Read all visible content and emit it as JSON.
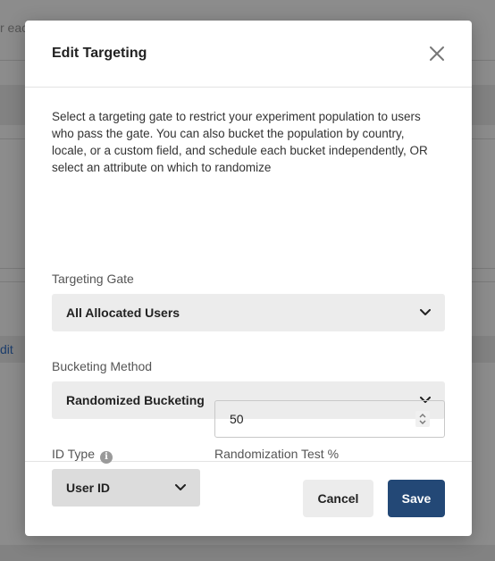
{
  "background": {
    "partial_text": "r eac",
    "partial_link": "dit"
  },
  "modal": {
    "title": "Edit Targeting",
    "description": "Select a targeting gate to restrict your experiment population to users who pass the gate. You can also bucket the population by country, locale, or a custom field, and schedule each bucket independently, OR select an attribute on which to randomize",
    "targeting_gate": {
      "label": "Targeting Gate",
      "value": "All Allocated Users"
    },
    "bucketing_method": {
      "label": "Bucketing Method",
      "value": "Randomized Bucketing"
    },
    "id_type": {
      "label": "ID Type",
      "value": "User ID"
    },
    "randomization_test": {
      "label": "Randomization Test %",
      "value": "50"
    },
    "cancel_label": "Cancel",
    "save_label": "Save"
  },
  "colors": {
    "primary": "#234876",
    "select_bg": "#ececec"
  }
}
